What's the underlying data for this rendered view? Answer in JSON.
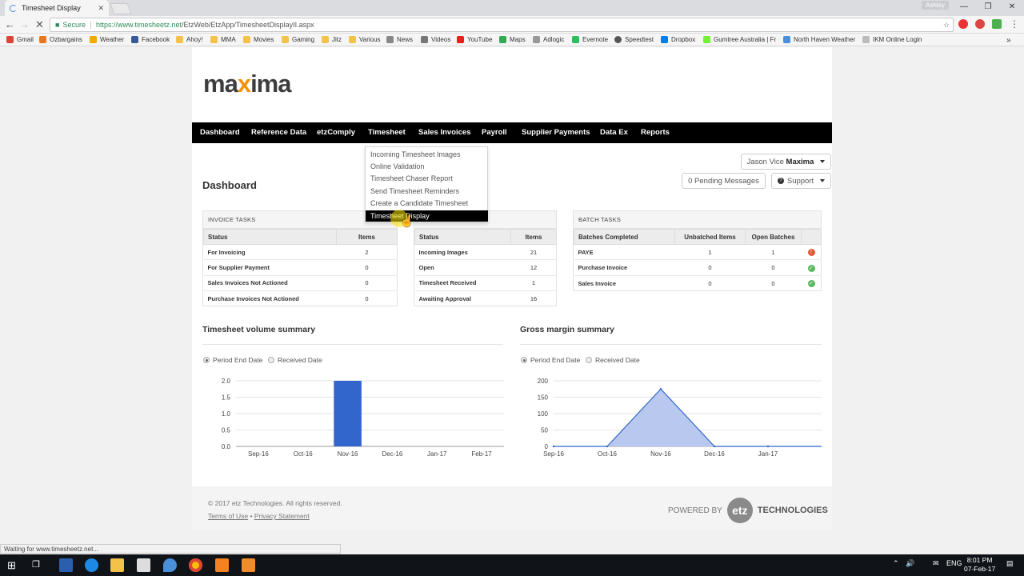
{
  "browser": {
    "tab_title": "Timesheet Display",
    "tab_close": "✕",
    "profile": "Ashley",
    "window_buttons": [
      "—",
      "❐",
      "✕"
    ],
    "secure_label": "Secure",
    "url_scheme_host": "https://www.timesheetz.net",
    "url_path": "/EtzWeb/EtzApp/TimesheetDisplayII.aspx",
    "bookmarks": [
      "Gmail",
      "Ozbargains",
      "Weather",
      "Facebook",
      "Ahoy!",
      "MMA",
      "Movies",
      "Gaming",
      "Jitz",
      "Various",
      "News",
      "Videos",
      "YouTube",
      "Maps",
      "Adlogic",
      "Evernote",
      "Speedtest",
      "Dropbox",
      "Gumtree Australia | Fr",
      "North Haven Weather",
      "IKM Online Login"
    ],
    "status_text": "Waiting for www.timesheetz.net..."
  },
  "nav": {
    "items": [
      "Dashboard",
      "Reference Data",
      "etzComply",
      "Timesheet",
      "Sales Invoices",
      "Payroll",
      "Supplier Payments",
      "Data Ex",
      "Reports"
    ]
  },
  "timesheet_menu": {
    "items": [
      "Incoming Timesheet Images",
      "Online Validation",
      "Timesheet Chaser Report",
      "Send Timesheet Reminders",
      "Create a Candidate Timesheet",
      "Timesheet Display"
    ],
    "active_index": 5
  },
  "user": {
    "name": "Jason Vice",
    "company": "Maxima"
  },
  "header_buttons": {
    "pending": "0 Pending Messages",
    "support": "Support"
  },
  "logo": {
    "pre": "ma",
    "x": "x",
    "post": "ima"
  },
  "page_title": "Dashboard",
  "invoice_tasks": {
    "title": "INVOICE TASKS",
    "headers": [
      "Status",
      "Items"
    ],
    "rows": [
      {
        "status": "For Invoicing",
        "items": "2"
      },
      {
        "status": "For Supplier Payment",
        "items": "0"
      },
      {
        "status": "Sales Invoices Not Actioned",
        "items": "0"
      },
      {
        "status": "Purchase Invoices Not Actioned",
        "items": "0"
      }
    ]
  },
  "timesheet_tasks": {
    "headers": [
      "Status",
      "Items"
    ],
    "rows": [
      {
        "status": "Incoming Images",
        "items": "21"
      },
      {
        "status": "Open",
        "items": "12"
      },
      {
        "status": "Timesheet Received",
        "items": "1"
      },
      {
        "status": "Awaiting Approval",
        "items": "16"
      }
    ]
  },
  "batch_tasks": {
    "title": "BATCH TASKS",
    "headers": [
      "Batches Completed",
      "Unbatched Items",
      "Open Batches"
    ],
    "rows": [
      {
        "name": "PAYE",
        "unbatched": "1",
        "open": "1",
        "state": "error"
      },
      {
        "name": "Purchase Invoice",
        "unbatched": "0",
        "open": "0",
        "state": "ok"
      },
      {
        "name": "Sales Invoice",
        "unbatched": "0",
        "open": "0",
        "state": "ok"
      }
    ],
    "state_colors": {
      "error": "#e05a3a",
      "ok": "#5cb85c"
    }
  },
  "radio_labels": {
    "period": "Period End Date",
    "received": "Received Date"
  },
  "chart_data": [
    {
      "type": "bar",
      "title": "Timesheet volume summary",
      "categories": [
        "Sep-16",
        "Oct-16",
        "Nov-16",
        "Dec-16",
        "Jan-17",
        "Feb-17"
      ],
      "values": [
        0,
        0,
        2,
        0,
        0,
        0
      ],
      "ylim": [
        0,
        2
      ],
      "yticks": [
        "2.0",
        "1.5",
        "1.0",
        "0.5",
        "0.0"
      ],
      "grid": true,
      "color": "#3366cc"
    },
    {
      "type": "area",
      "title": "Gross margin summary",
      "categories": [
        "Sep-16",
        "Oct-16",
        "Nov-16",
        "Dec-16",
        "Jan-17"
      ],
      "values": [
        0,
        0,
        175,
        0,
        0
      ],
      "ylim": [
        0,
        200
      ],
      "yticks": [
        "200",
        "150",
        "100",
        "50",
        "0"
      ],
      "grid": true,
      "color": "#3366cc"
    }
  ],
  "footer": {
    "copyright": "© 2017 etz Technologies. All rights reserved.",
    "terms": "Terms of Use",
    "sep": "•",
    "privacy": "Privacy Statement",
    "powered_by": "POWERED BY",
    "etz": "etz",
    "technologies": "TECHNOLOGIES"
  },
  "taskbar": {
    "time": "8:01 PM",
    "date": "07-Feb-17",
    "lang": "ENG"
  }
}
